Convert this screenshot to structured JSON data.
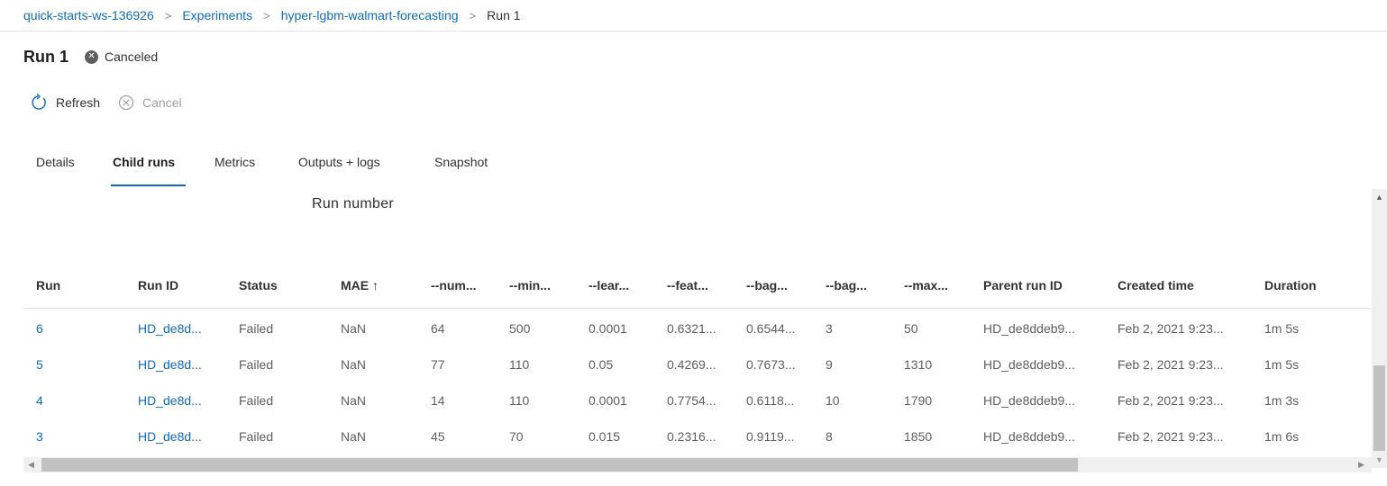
{
  "breadcrumb": {
    "items": [
      {
        "label": "quick-starts-ws-136926"
      },
      {
        "label": "Experiments"
      },
      {
        "label": "hyper-lgbm-walmart-forecasting"
      },
      {
        "label": "Run 1"
      }
    ],
    "separator": ">"
  },
  "run": {
    "title": "Run 1",
    "status": "Canceled",
    "status_color": "#605e5c"
  },
  "toolbar": {
    "refresh_label": "Refresh",
    "refresh_icon": "refresh-icon",
    "cancel_label": "Cancel",
    "cancel_icon": "cancel-circle-icon"
  },
  "tabs": [
    {
      "label": "Details",
      "active": false
    },
    {
      "label": "Child runs",
      "active": true
    },
    {
      "label": "Metrics",
      "active": false
    },
    {
      "label": "Outputs + logs",
      "active": false
    },
    {
      "label": "Snapshot",
      "active": false
    }
  ],
  "grid": {
    "group_label": "Run number",
    "columns": [
      "Run",
      "Run ID",
      "Status",
      "MAE ↑",
      "--num...",
      "--min...",
      "--lear...",
      "--feat...",
      "--bag...",
      "--bag...",
      "--max...",
      "Parent run ID",
      "Created time",
      "Duration"
    ],
    "rows": [
      [
        "6",
        "HD_de8d...",
        "Failed",
        "NaN",
        "64",
        "500",
        "0.0001",
        "0.6321...",
        "0.6544...",
        "3",
        "50",
        "HD_de8ddeb9...",
        "Feb 2, 2021 9:23...",
        "1m 5s"
      ],
      [
        "5",
        "HD_de8d...",
        "Failed",
        "NaN",
        "77",
        "110",
        "0.05",
        "0.4269...",
        "0.7673...",
        "9",
        "1310",
        "HD_de8ddeb9...",
        "Feb 2, 2021 9:23...",
        "1m 5s"
      ],
      [
        "4",
        "HD_de8d...",
        "Failed",
        "NaN",
        "14",
        "110",
        "0.0001",
        "0.7754...",
        "0.6118...",
        "10",
        "1790",
        "HD_de8ddeb9...",
        "Feb 2, 2021 9:23...",
        "1m 3s"
      ],
      [
        "3",
        "HD_de8d...",
        "Failed",
        "NaN",
        "45",
        "70",
        "0.015",
        "0.2316...",
        "0.9119...",
        "8",
        "1850",
        "HD_de8ddeb9...",
        "Feb 2, 2021 9:23...",
        "1m 6s"
      ]
    ]
  },
  "colors": {
    "link": "#0f6cbd",
    "accent": "#0f6cbd",
    "text": "#323130",
    "muted": "#605e5c"
  }
}
